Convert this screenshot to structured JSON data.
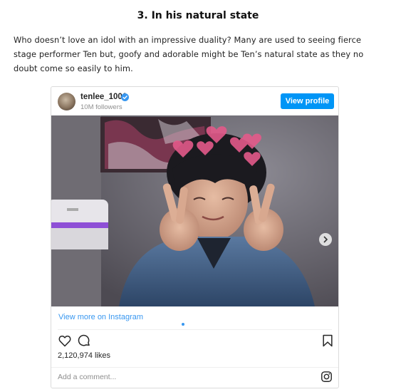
{
  "article": {
    "heading": "3. In his natural state",
    "paragraph": "Who doesn’t love an idol with an impressive duality? Many are used to seeing fierce stage performer Ten but, goofy and adorable might be Ten’s natural state as they no doubt come so easily to him."
  },
  "instagram": {
    "username": "tenlee_1001",
    "followers": "10M followers",
    "view_profile_label": "View profile",
    "view_more_label": "View more on Instagram",
    "likes": "2,120,974 likes",
    "comment_placeholder": "Add a comment...",
    "carousel": {
      "slide_count": 5,
      "active_slide": 1
    },
    "colors": {
      "accent": "#0095f6",
      "link": "#3897f0"
    },
    "icons": [
      "verified-badge-icon",
      "carousel-next-icon",
      "heart-icon",
      "comment-icon",
      "bookmark-icon",
      "instagram-logo-icon"
    ]
  }
}
